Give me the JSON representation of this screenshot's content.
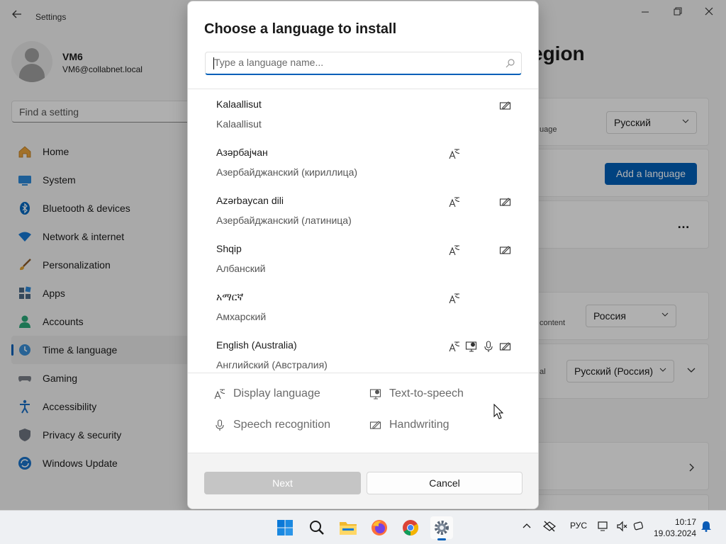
{
  "app": {
    "title": "Settings",
    "back_icon": "back-arrow-icon"
  },
  "window_controls": {
    "minimize": "—",
    "maximize": "❐",
    "close": "✕"
  },
  "profile": {
    "name": "VM6",
    "email": "VM6@collabnet.local"
  },
  "search": {
    "placeholder": "Find a setting"
  },
  "nav": {
    "items": [
      {
        "label": "Home",
        "icon": "home-icon"
      },
      {
        "label": "System",
        "icon": "system-icon"
      },
      {
        "label": "Bluetooth & devices",
        "icon": "bluetooth-icon"
      },
      {
        "label": "Network & internet",
        "icon": "wifi-icon"
      },
      {
        "label": "Personalization",
        "icon": "brush-icon"
      },
      {
        "label": "Apps",
        "icon": "apps-icon"
      },
      {
        "label": "Accounts",
        "icon": "accounts-icon"
      },
      {
        "label": "Time & language",
        "icon": "clock-globe-icon",
        "active": true
      },
      {
        "label": "Gaming",
        "icon": "gamepad-icon"
      },
      {
        "label": "Accessibility",
        "icon": "accessibility-icon"
      },
      {
        "label": "Privacy & security",
        "icon": "shield-icon"
      },
      {
        "label": "Windows Update",
        "icon": "update-icon"
      }
    ]
  },
  "page": {
    "title_visible": "egion",
    "display_lang_suffix": "uage",
    "display_lang_value": "Русский",
    "add_language": "Add a language",
    "more": "…",
    "region_suffix": "content",
    "region_value": "Россия",
    "format_suffix": "al",
    "format_value": "Русский (Россия)"
  },
  "dialog": {
    "title": "Choose a language to install",
    "search_placeholder": "Type a language name...",
    "languages": [
      {
        "native": "Kalaallisut",
        "localized": "Kalaallisut",
        "features": [
          "handwriting"
        ]
      },
      {
        "native": "Азәрбајҹан",
        "localized": "Азербайджанский (кириллица)",
        "features": [
          "display"
        ]
      },
      {
        "native": "Azərbaycan dili",
        "localized": "Азербайджанский (латиница)",
        "features": [
          "display",
          "handwriting"
        ]
      },
      {
        "native": "Shqip",
        "localized": "Албанский",
        "features": [
          "display",
          "handwriting"
        ]
      },
      {
        "native": "አማርኛ",
        "localized": "Амхарский",
        "features": [
          "display"
        ]
      },
      {
        "native": "English (Australia)",
        "localized": "Английский (Австралия)",
        "features": [
          "display",
          "tts",
          "speech",
          "handwriting"
        ]
      }
    ],
    "legend": {
      "display": "Display language",
      "tts": "Text-to-speech",
      "speech": "Speech recognition",
      "handwriting": "Handwriting"
    },
    "next": "Next",
    "cancel": "Cancel"
  },
  "taskbar": {
    "apps": [
      "windows-start-icon",
      "search-icon",
      "file-explorer-icon",
      "firefox-icon",
      "chrome-icon",
      "settings-icon"
    ],
    "tray": {
      "lang": "РУС",
      "time": "10:17",
      "date": "19.03.2024"
    }
  },
  "colors": {
    "accent": "#005fb8",
    "dim": "rgba(0,0,0,0.3)"
  }
}
